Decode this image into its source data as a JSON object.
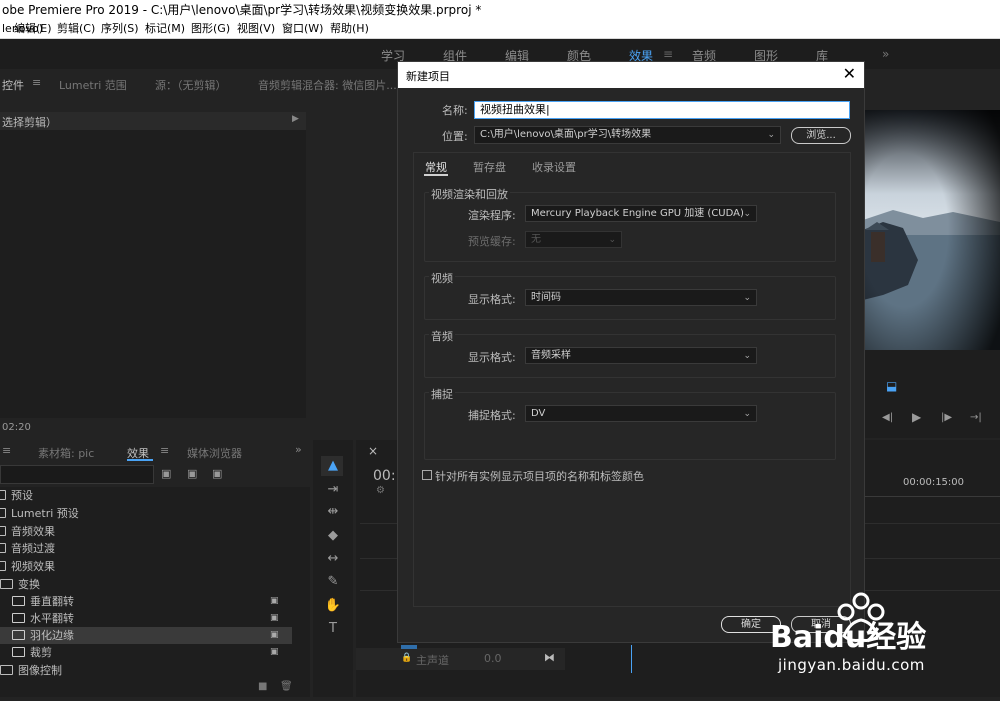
{
  "titlebar": {
    "text": "obe Premiere Pro 2019 - C:\\用户\\lenovo\\桌面\\pr学习\\转场效果\\视频变换效果.prproj *"
  },
  "menubar": {
    "items": [
      "lenovo)",
      "编辑(E)",
      "剪辑(C)",
      "序列(S)",
      "标记(M)",
      "图形(G)",
      "视图(V)",
      "窗口(W)",
      "帮助(H)"
    ]
  },
  "workspaces": {
    "items": [
      "学习",
      "组件",
      "编辑",
      "颜色",
      "效果",
      "音频",
      "图形",
      "库"
    ],
    "active": "效果",
    "more": "»"
  },
  "source_panel": {
    "tabs": [
      "控件",
      "Lumetri 范围",
      "源：（无剪辑）",
      "音频剪辑混合器: 微信图片..."
    ],
    "subheader": "选择剪辑）",
    "timecode": "02:20"
  },
  "effects_panel": {
    "tabs": [
      "素材箱: pic",
      "效果",
      "媒体浏览器"
    ],
    "more": "»",
    "tree": [
      {
        "label": "预设",
        "indent": 0
      },
      {
        "label": "Lumetri 预设",
        "indent": 0
      },
      {
        "label": "音频效果",
        "indent": 0
      },
      {
        "label": "音频过渡",
        "indent": 0
      },
      {
        "label": "视频效果",
        "indent": 0
      },
      {
        "label": "变换",
        "indent": 0
      },
      {
        "label": "垂直翻转",
        "indent": 1
      },
      {
        "label": "水平翻转",
        "indent": 1
      },
      {
        "label": "羽化边缘",
        "indent": 1,
        "selected": true
      },
      {
        "label": "裁剪",
        "indent": 1
      },
      {
        "label": "图像控制",
        "indent": 0
      }
    ]
  },
  "tools": {
    "icons": [
      "selection-tool-icon",
      "track-select-icon",
      "ripple-edit-icon",
      "razor-icon",
      "slip-icon",
      "pen-icon",
      "hand-icon",
      "type-icon"
    ]
  },
  "timeline": {
    "timecode_partial": "00:",
    "ruler_time": "00:00:15:00",
    "track_label": "主声道",
    "track_value": "0.0",
    "tab_close": "×"
  },
  "dialog": {
    "title": "新建项目",
    "close": "✕",
    "name_label": "名称:",
    "name_value": "视频扭曲效果",
    "location_label": "位置:",
    "location_value": "C:\\用户\\lenovo\\桌面\\pr学习\\转场效果",
    "browse_label": "浏览...",
    "tabs": [
      "常规",
      "暂存盘",
      "收录设置"
    ],
    "active_tab": "常规",
    "section_render": {
      "header": "视频渲染和回放",
      "renderer_label": "渲染程序:",
      "renderer_value": "Mercury Playback Engine GPU 加速 (CUDA)",
      "preview_cache_label": "预览缓存:",
      "preview_cache_value": "无"
    },
    "section_video": {
      "header": "视频",
      "format_label": "显示格式:",
      "format_value": "时间码"
    },
    "section_audio": {
      "header": "音频",
      "format_label": "显示格式:",
      "format_value": "音频采样"
    },
    "section_capture": {
      "header": "捕捉",
      "format_label": "捕捉格式:",
      "format_value": "DV"
    },
    "checkbox_label": "针对所有实例显示项目项的名称和标签颜色",
    "ok_label": "确定",
    "cancel_label": "取消"
  },
  "watermark": {
    "brand": "Baidu经验",
    "url": "jingyan.baidu.com"
  },
  "colors": {
    "accent": "#4aa3f5",
    "dialog_bg": "#262626",
    "panel_bg": "#1e1e1e"
  }
}
